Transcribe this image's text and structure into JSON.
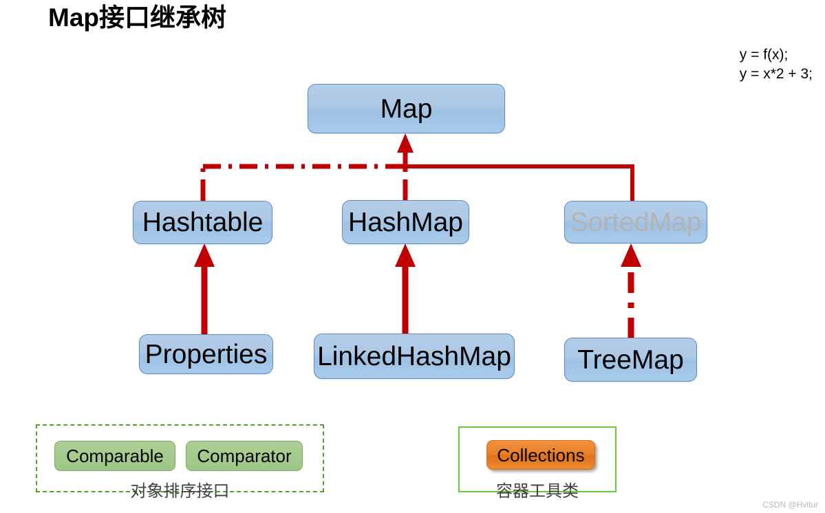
{
  "page": {
    "title": "Map接口继承树",
    "watermark": "CSDN @Hvitur"
  },
  "note": {
    "line1": "y = f(x);",
    "line2": "y = x*2 + 3;"
  },
  "nodes": {
    "map": "Map",
    "hashtable": "Hashtable",
    "hashmap": "HashMap",
    "sortedmap": "SortedMap",
    "properties": "Properties",
    "linkedhashmap": "LinkedHashMap",
    "treemap": "TreeMap"
  },
  "groups": {
    "sorting": {
      "caption": "对象排序接口",
      "items": [
        {
          "label": "Comparable"
        },
        {
          "label": "Comparator"
        }
      ]
    },
    "utility": {
      "caption": "容器工具类",
      "items": [
        {
          "label": "Collections"
        }
      ]
    }
  },
  "colors": {
    "arrow": "#c00000",
    "node_fill": "#aacbe8",
    "node_border": "#5b8cc0",
    "interface_text": "#b3b3b3",
    "green_fill": "#a6cb8e",
    "green_border": "#7aab63",
    "orange_fill": "#e8821f",
    "group_dashed_border": "#4ea32e",
    "group_solid_border": "#6fc33d"
  }
}
